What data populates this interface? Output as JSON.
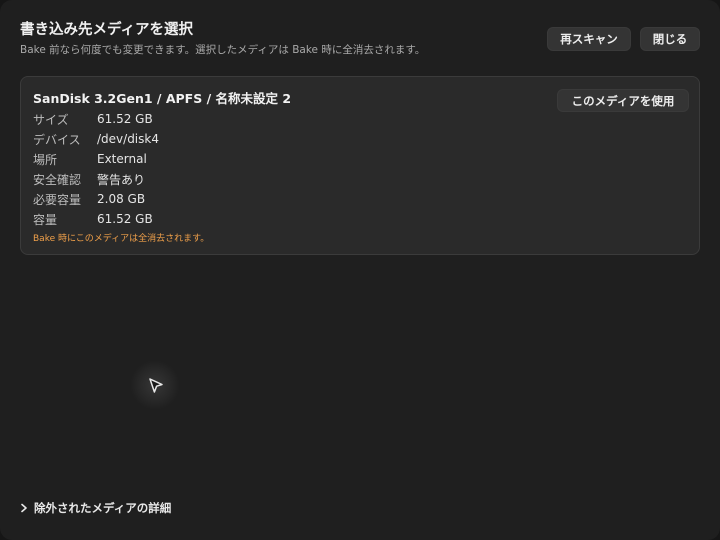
{
  "header": {
    "title": "書き込み先メディアを選択",
    "subtitle": "Bake 前なら何度でも変更できます。選択したメディアは Bake 時に全消去されます。"
  },
  "buttons": {
    "rescan": "再スキャン",
    "close": "閉じる"
  },
  "media_card": {
    "title": "SanDisk 3.2Gen1 / APFS / 名称未設定 2",
    "use_button": "このメディアを使用",
    "rows": [
      {
        "label": "サイズ",
        "value": "61.52 GB"
      },
      {
        "label": "デバイス",
        "value": "/dev/disk4"
      },
      {
        "label": "場所",
        "value": "External"
      },
      {
        "label": "安全確認",
        "value": "警告あり"
      },
      {
        "label": "必要容量",
        "value": "2.08 GB"
      },
      {
        "label": "容量",
        "value": "61.52 GB"
      }
    ],
    "warning": "Bake 時にこのメディアは全消去されます。"
  },
  "footer": {
    "excluded_details": "除外されたメディアの詳細"
  },
  "icons": {
    "cursor": "pointer-cursor-icon",
    "expand": "chevron-right-icon"
  },
  "colors": {
    "warning": "#f0a04a",
    "background": "#1f1f1f",
    "card": "#2a2a2a"
  }
}
